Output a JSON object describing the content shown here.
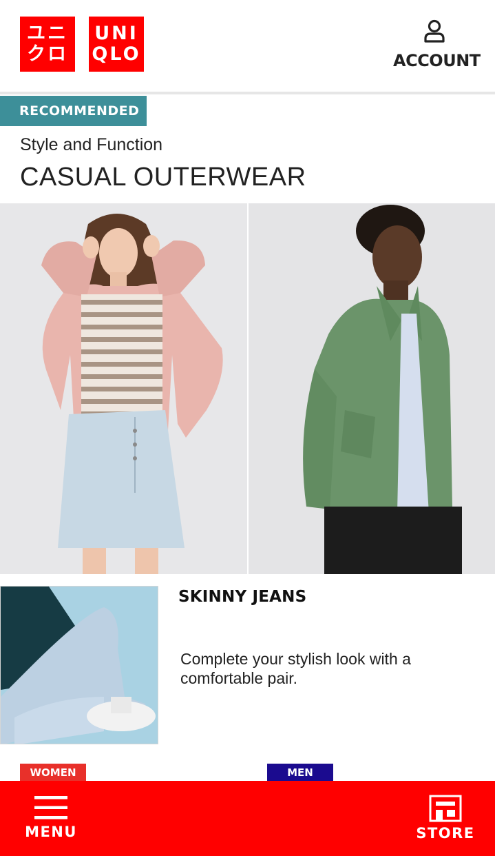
{
  "brand": {
    "logo_left_text": "ユニ\nクロ",
    "logo_right_text": "UNI\nQLO",
    "color": "#ff0000"
  },
  "header": {
    "account_label": "ACCOUNT",
    "account_icon": "user-icon"
  },
  "recommended": {
    "badge": "RECOMMENDED",
    "badge_color": "#3d8f99",
    "subtitle": "Style and Function",
    "title": "CASUAL OUTERWEAR"
  },
  "feature": {
    "title": "SKINNY JEANS",
    "description": "Complete your stylish look with a comfortable pair."
  },
  "tags": {
    "women": "WOMEN",
    "women_color": "#e8302a",
    "men": "MEN",
    "men_color": "#1b0b8f"
  },
  "bottom_nav": {
    "menu_label": "MENU",
    "menu_icon": "hamburger-icon",
    "store_label": "STORE",
    "store_icon": "store-icon"
  }
}
